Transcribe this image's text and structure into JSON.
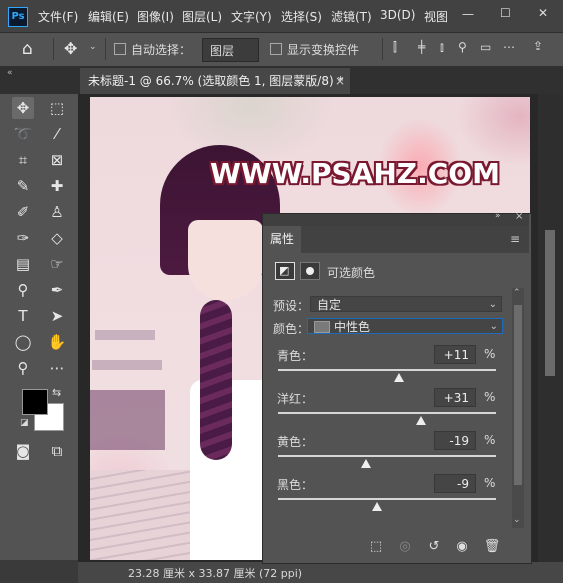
{
  "app": {
    "logo": "Ps"
  },
  "menu": {
    "items": [
      "文件(F)",
      "编辑(E)",
      "图像(I)",
      "图层(L)",
      "文字(Y)",
      "选择(S)",
      "滤镜(T)",
      "3D(D)",
      "视图"
    ]
  },
  "window_controls": {
    "minimize": "—",
    "maximize": "☐",
    "close": "✕"
  },
  "options_bar": {
    "auto_select_label": "自动选择：",
    "auto_select_target": "图层",
    "show_transform_label": "显示变换控件"
  },
  "document_tab": {
    "title": "未标题-1 @ 66.7% (选取颜色 1, 图层蒙版/8) *",
    "close": "×"
  },
  "canvas": {
    "watermark": "WWW.PSAHZ.COM"
  },
  "status_bar": {
    "text": "23.28 厘米 x 33.87 厘米 (72 ppi)"
  },
  "properties_panel": {
    "tab_label": "属性",
    "adjustment_title": "可选颜色",
    "preset_label": "预设：",
    "preset_value": "自定",
    "color_label": "颜色：",
    "color_value": "中性色",
    "color_swatch": "#7a7a7a",
    "sliders": [
      {
        "label": "青色：",
        "value": "+11",
        "unit": "%",
        "fraction": 0.555
      },
      {
        "label": "洋红：",
        "value": "+31",
        "unit": "%",
        "fraction": 0.655
      },
      {
        "label": "黄色：",
        "value": "-19",
        "unit": "%",
        "fraction": 0.405
      },
      {
        "label": "黑色：",
        "value": "-9",
        "unit": "%",
        "fraction": 0.455
      }
    ]
  },
  "colors": {
    "foreground": "#000000",
    "background": "#ffffff",
    "accent": "#31a8ff"
  }
}
